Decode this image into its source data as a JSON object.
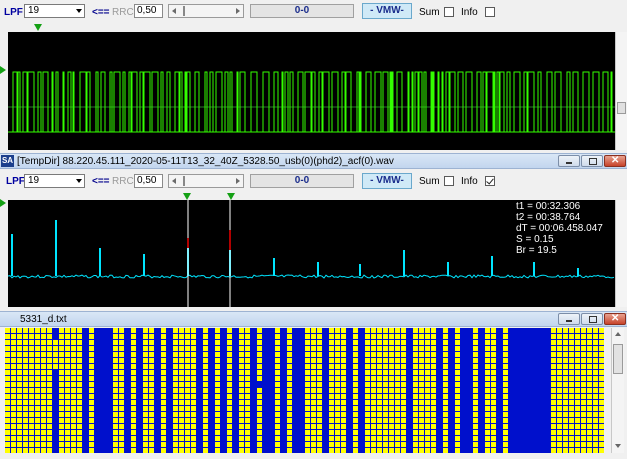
{
  "top_toolbar": {
    "lpf_label": "LPF",
    "lpf_value": "19",
    "arrow_label": "<==",
    "rrc_label": "RRC",
    "rrc_value": "0,50",
    "ratio_value": "0-0",
    "vmw_label": "- VMW-",
    "sum_label": "Sum",
    "info_label": "Info",
    "info_checked": false
  },
  "acf_window": {
    "title": "[TempDir] 88.220.45.111_2020-05-11T13_32_40Z_5328.50_usb(0)(phd2)_acf(0).wav",
    "app_icon": "SA",
    "toolbar": {
      "lpf_label": "LPF",
      "lpf_value": "19",
      "arrow_label": "<==",
      "rrc_label": "RRC",
      "rrc_value": "0,50",
      "ratio_value": "0-0",
      "vmw_label": "- VMW-",
      "sum_label": "Sum",
      "info_label": "Info",
      "info_checked": true
    },
    "readout": {
      "t1": "t1 = 00:32.306",
      "t2": "t2 = 00:38.764",
      "dt": "dT = 00:06.458.047",
      "s": "S = 0.15",
      "br": "Br = 19.5"
    }
  },
  "bits_window": {
    "title": "5331_d.txt"
  },
  "colors": {
    "signal_green": "#33ff00",
    "acf_cyan": "#00e5ff",
    "bits_yellow": "#ffff00",
    "bits_blue": "#0010cc"
  },
  "icons": [
    "dropdown-arrow-icon",
    "marker-triangle-icon",
    "minimize-icon",
    "maximize-icon",
    "close-icon",
    "app-icon"
  ]
}
